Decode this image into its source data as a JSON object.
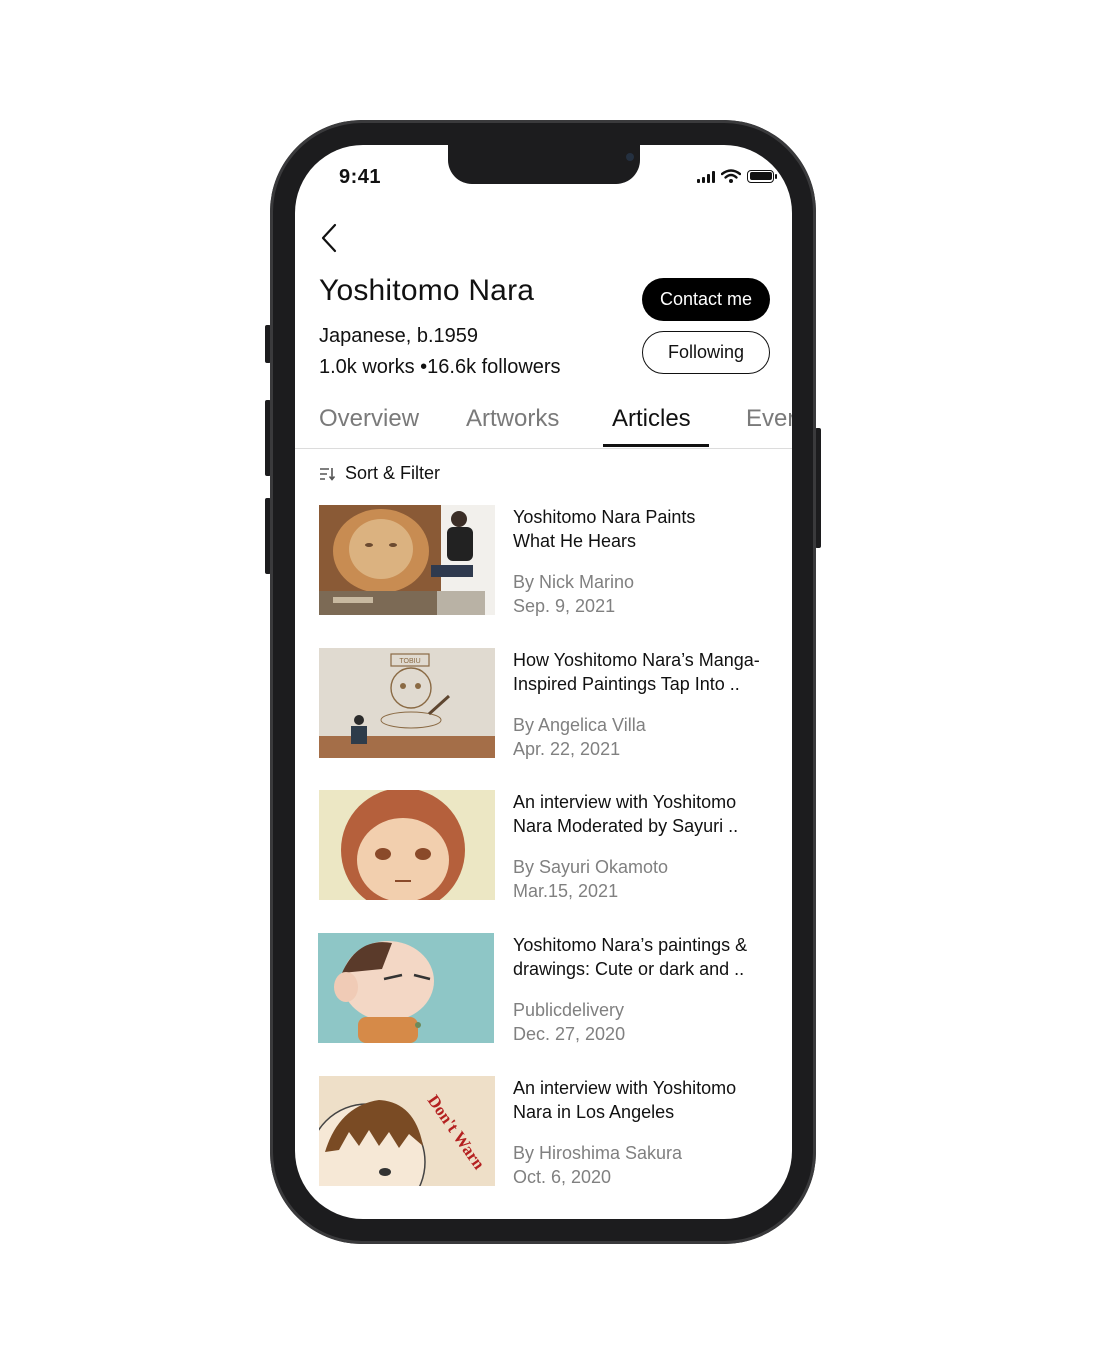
{
  "status_bar": {
    "time": "9:41"
  },
  "artist": {
    "name": "Yoshitomo Nara",
    "meta": "Japanese, b.1959",
    "stats": "1.0k works •16.6k followers"
  },
  "actions": {
    "contact_label": "Contact me",
    "following_label": "Following"
  },
  "tabs": [
    {
      "label": "Overview",
      "active": false
    },
    {
      "label": "Artworks",
      "active": false
    },
    {
      "label": "Articles",
      "active": true
    },
    {
      "label": "Ever",
      "active": false
    }
  ],
  "sort_filter": {
    "label": "Sort & Filter"
  },
  "articles": [
    {
      "title": "Yoshitomo Nara Paints\n What He Hears",
      "author": "By Nick Marino",
      "date": "Sep. 9, 2021"
    },
    {
      "title": "How Yoshitomo Nara’s Manga-\nInspired Paintings Tap Into ..",
      "author": "By Angelica Villa",
      "date": "Apr. 22, 2021"
    },
    {
      "title": "An interview with Yoshitomo\nNara Moderated by Sayuri ..",
      "author": "By Sayuri Okamoto",
      "date": "Mar.15, 2021"
    },
    {
      "title": "Yoshitomo Nara’s paintings &\ndrawings: Cute or dark and ..",
      "author": "Publicdelivery",
      "date": "Dec. 27, 2020"
    },
    {
      "title": "An interview with Yoshitomo\nNara in Los Angeles",
      "author": "By  Hiroshima Sakura",
      "date": "Oct. 6, 2020"
    }
  ],
  "thumb_texts": {
    "sign": "TOBIU",
    "dont_warn": "Don't Warn"
  }
}
